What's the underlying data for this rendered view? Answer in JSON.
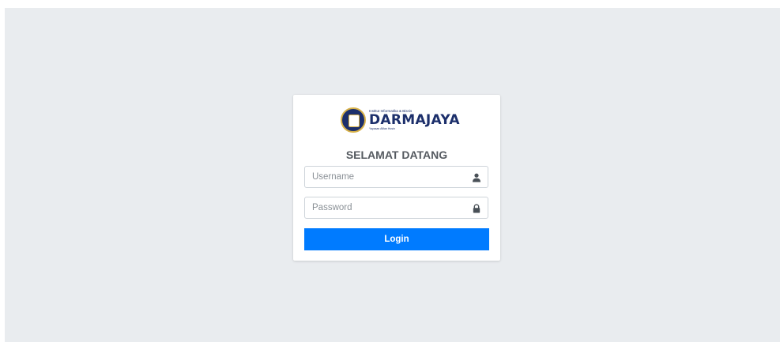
{
  "brand": {
    "institution": "Institut Informatika & Bisnis",
    "name": "DARMAJAYA",
    "tagline": "Yayasan Alfian Husin"
  },
  "login": {
    "title": "SELAMAT DATANG",
    "username": {
      "placeholder": "Username",
      "value": "",
      "icon": "user-icon"
    },
    "password": {
      "placeholder": "Password",
      "value": "",
      "icon": "lock-icon"
    },
    "submit_label": "Login"
  },
  "colors": {
    "page_background": "#e9ecef",
    "card_background": "#ffffff",
    "primary": "#007bff",
    "brand_navy": "#1c2f6b",
    "brand_gold": "#d8b24a"
  }
}
